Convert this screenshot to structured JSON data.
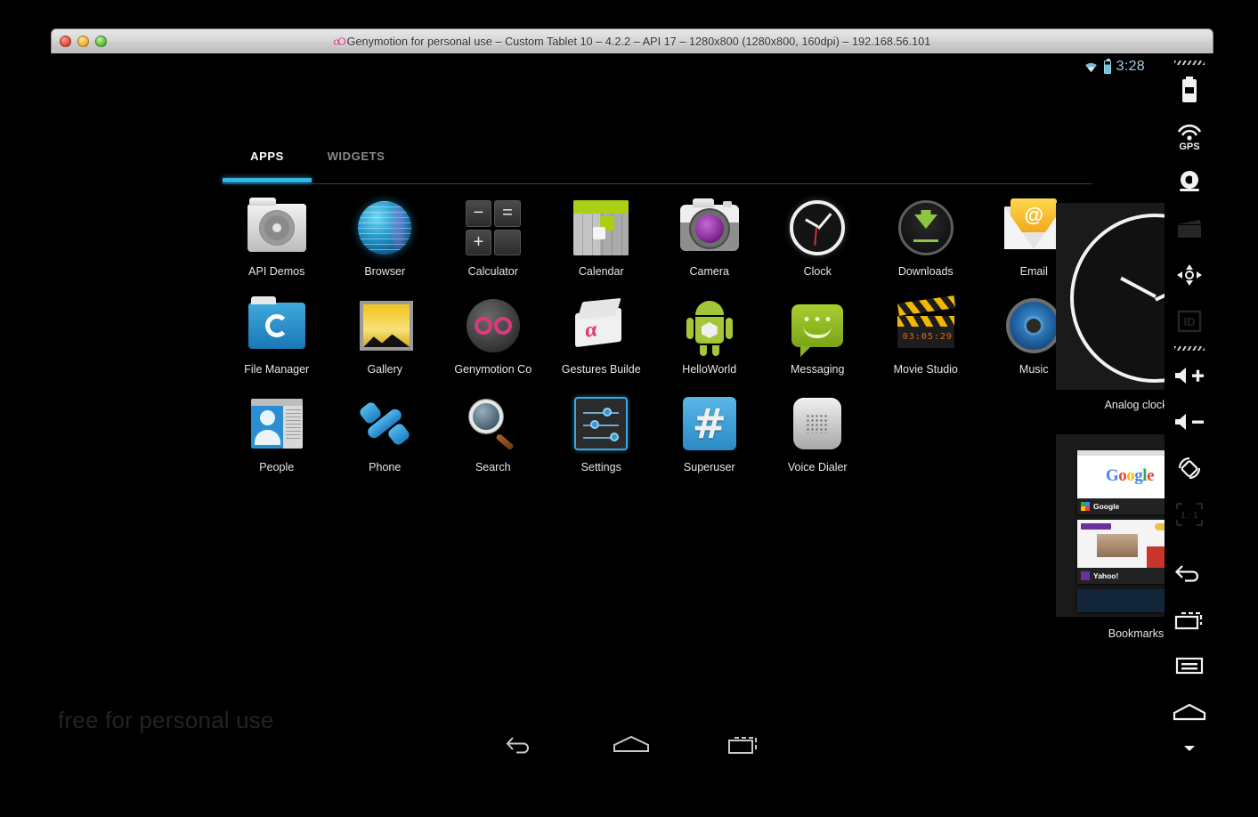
{
  "window": {
    "title": "Genymotion for personal use – Custom Tablet 10 – 4.2.2 – API 17 – 1280x800 (1280x800, 160dpi) – 192.168.56.101",
    "logo_mark": "oO",
    "controls": {
      "close": "close-button",
      "minimize": "minimize-button",
      "zoom": "zoom-button"
    }
  },
  "statusbar": {
    "wifi": "wifi-icon",
    "battery": "battery-icon",
    "clock": "3:28"
  },
  "launcher": {
    "tabs": [
      {
        "label": "APPS",
        "active": true
      },
      {
        "label": "WIDGETS",
        "active": false
      }
    ],
    "apps": [
      {
        "label": "API Demos",
        "icon": "api-demos-icon"
      },
      {
        "label": "Browser",
        "icon": "browser-icon"
      },
      {
        "label": "Calculator",
        "icon": "calculator-icon"
      },
      {
        "label": "Calendar",
        "icon": "calendar-icon"
      },
      {
        "label": "Camera",
        "icon": "camera-icon"
      },
      {
        "label": "Clock",
        "icon": "clock-icon"
      },
      {
        "label": "Downloads",
        "icon": "downloads-icon"
      },
      {
        "label": "Email",
        "icon": "email-icon"
      },
      {
        "label": "File Manager",
        "icon": "file-manager-icon"
      },
      {
        "label": "Gallery",
        "icon": "gallery-icon"
      },
      {
        "label": "Genymotion Co",
        "icon": "genymotion-config-icon"
      },
      {
        "label": "Gestures Builde",
        "icon": "gestures-builder-icon"
      },
      {
        "label": "HelloWorld",
        "icon": "helloworld-icon"
      },
      {
        "label": "Messaging",
        "icon": "messaging-icon"
      },
      {
        "label": "Movie Studio",
        "icon": "movie-studio-icon"
      },
      {
        "label": "Music",
        "icon": "music-icon"
      },
      {
        "label": "People",
        "icon": "people-icon"
      },
      {
        "label": "Phone",
        "icon": "phone-icon"
      },
      {
        "label": "Search",
        "icon": "search-icon"
      },
      {
        "label": "Settings",
        "icon": "settings-icon"
      },
      {
        "label": "Superuser",
        "icon": "superuser-icon"
      },
      {
        "label": "Voice Dialer",
        "icon": "voice-dialer-icon"
      }
    ],
    "calculator_keys": [
      "−",
      "=",
      "+",
      ""
    ],
    "superuser_glyph": "#",
    "movie_studio_digits": "03:05:29"
  },
  "widgets": [
    {
      "label": "Analog clock",
      "name": "widget-analog-clock"
    },
    {
      "label": "Bookmarks",
      "name": "widget-bookmarks"
    }
  ],
  "bookmarks_widget": {
    "items": [
      {
        "title": "Google",
        "letters": [
          "G",
          "o",
          "o",
          "g",
          "l",
          "e"
        ]
      },
      {
        "title": "Yahoo!",
        "letters": []
      }
    ]
  },
  "navbar": {
    "back": "back-button",
    "home": "home-button",
    "recents": "recents-button"
  },
  "watermark": "free for personal use",
  "toolrail": [
    {
      "name": "battery-tool",
      "dim": false
    },
    {
      "name": "gps-tool",
      "dim": false,
      "label": "GPS"
    },
    {
      "name": "camera-tool",
      "dim": false
    },
    {
      "name": "video-capture-tool",
      "dim": true
    },
    {
      "name": "dpad-tool",
      "dim": false
    },
    {
      "name": "identifiers-tool",
      "dim": true,
      "label": "ID"
    },
    {
      "name": "volume-up-tool",
      "dim": false
    },
    {
      "name": "volume-down-tool",
      "dim": false
    },
    {
      "name": "rotate-tool",
      "dim": false
    },
    {
      "name": "scale-one-to-one-tool",
      "dim": true,
      "label": "1 : 1"
    },
    {
      "name": "back-tool",
      "dim": false
    },
    {
      "name": "recents-tool",
      "dim": false
    },
    {
      "name": "menu-tool",
      "dim": false
    },
    {
      "name": "home-tool",
      "dim": false
    },
    {
      "name": "expand-tool",
      "dim": false
    }
  ],
  "colors": {
    "accent_blue": "#33b5e5",
    "status_clock": "#9fd0e0",
    "genymotion_pink": "#e0377d",
    "android_green": "#a4c639",
    "background": "#000000"
  }
}
